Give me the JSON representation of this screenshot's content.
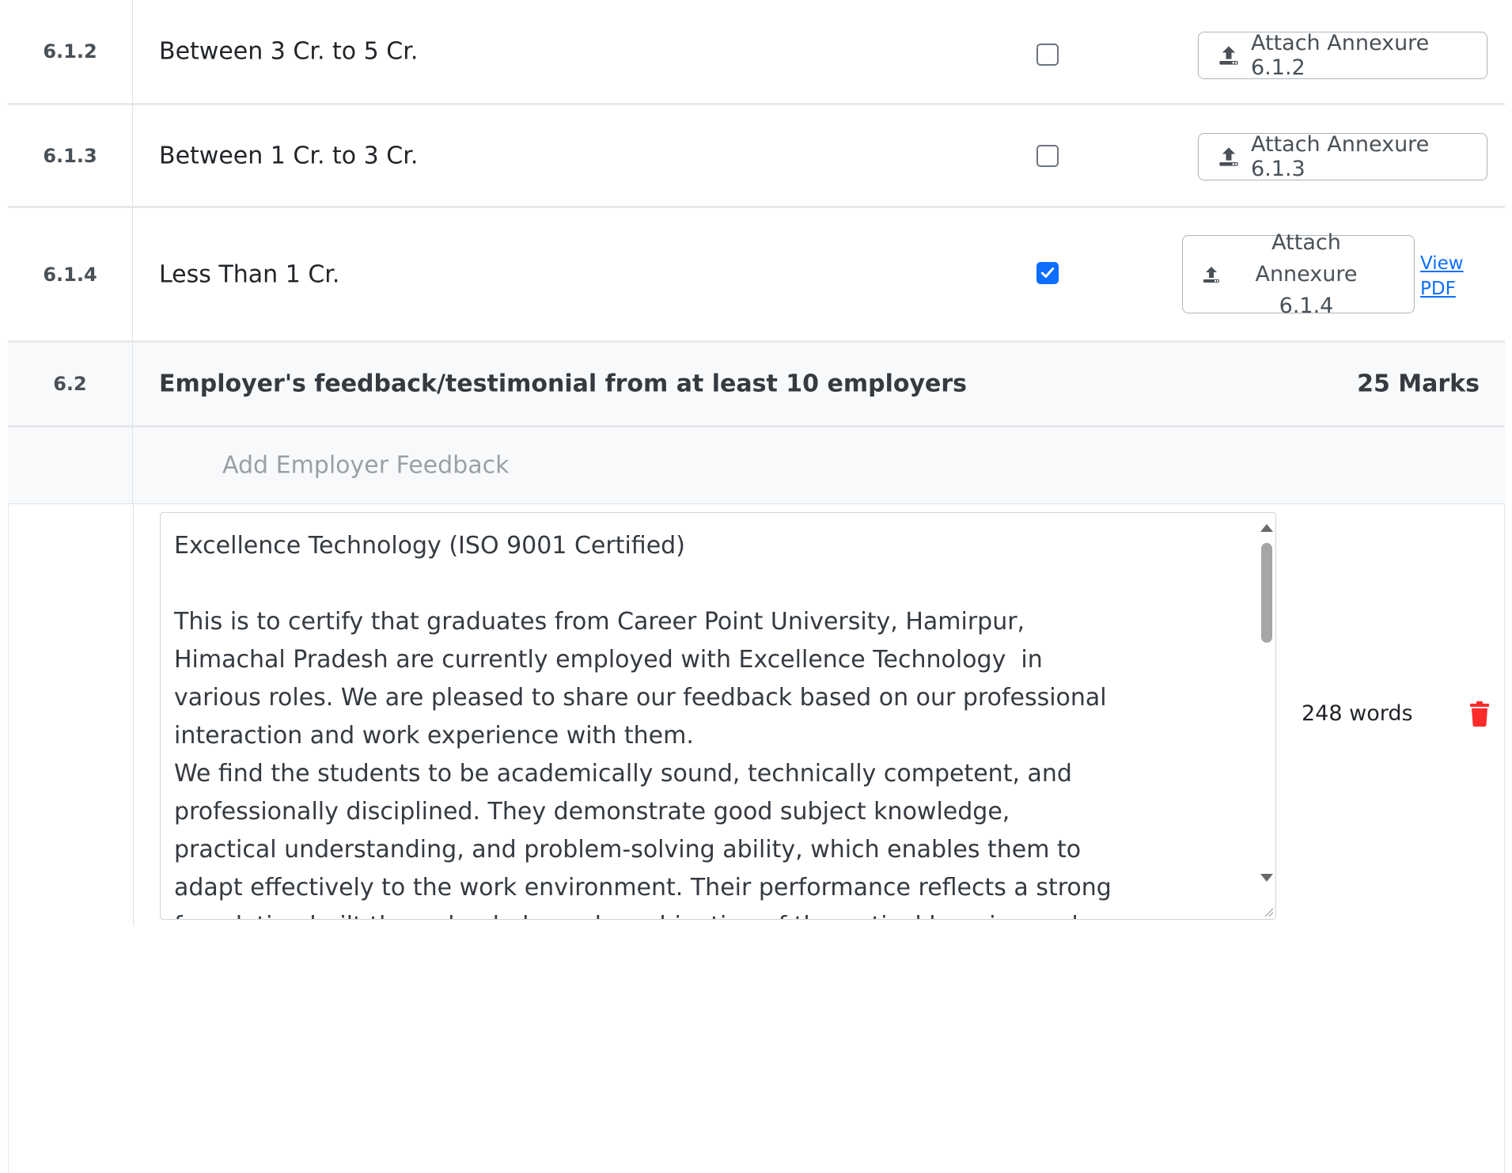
{
  "rows": [
    {
      "number": "6.1.2",
      "label": "Between 3 Cr. to 5 Cr.",
      "checked": false,
      "attach_label": "Attach Annexure 6.1.2"
    },
    {
      "number": "6.1.3",
      "label": "Between 1 Cr. to 3 Cr.",
      "checked": false,
      "attach_label": "Attach Annexure 6.1.3"
    },
    {
      "number": "6.1.4",
      "label": "Less Than 1 Cr.",
      "checked": true,
      "attach_label_line1": "Attach",
      "attach_label_line2": "Annexure 6.1.4",
      "view_line1": "View",
      "view_line2": "PDF"
    }
  ],
  "section": {
    "number": "6.2",
    "title": "Employer's feedback/testimonial from at least 10 employers",
    "marks": "25 Marks"
  },
  "feedback": {
    "add_placeholder": "Add Employer Feedback",
    "text": "Excellence Technology (ISO 9001 Certified)\n\nThis is to certify that graduates from Career Point University, Hamirpur, Himachal Pradesh are currently employed with Excellence Technology  in various roles. We are pleased to share our feedback based on our professional interaction and work experience with them.\nWe find the students to be academically sound, technically competent, and professionally disciplined. They demonstrate good subject knowledge, practical understanding, and problem-solving ability, which enables them to adapt effectively to the work environment. Their performance reflects a strong foundation built through a balanced combination of theoretical learning and practical exposure.",
    "word_count": "248 words"
  },
  "colors": {
    "accent": "#0d6efd",
    "danger": "#ff2b2b",
    "border": "#dee2e6"
  },
  "icons": {
    "upload": "upload-icon",
    "delete": "trash-icon",
    "check": "check-icon"
  }
}
